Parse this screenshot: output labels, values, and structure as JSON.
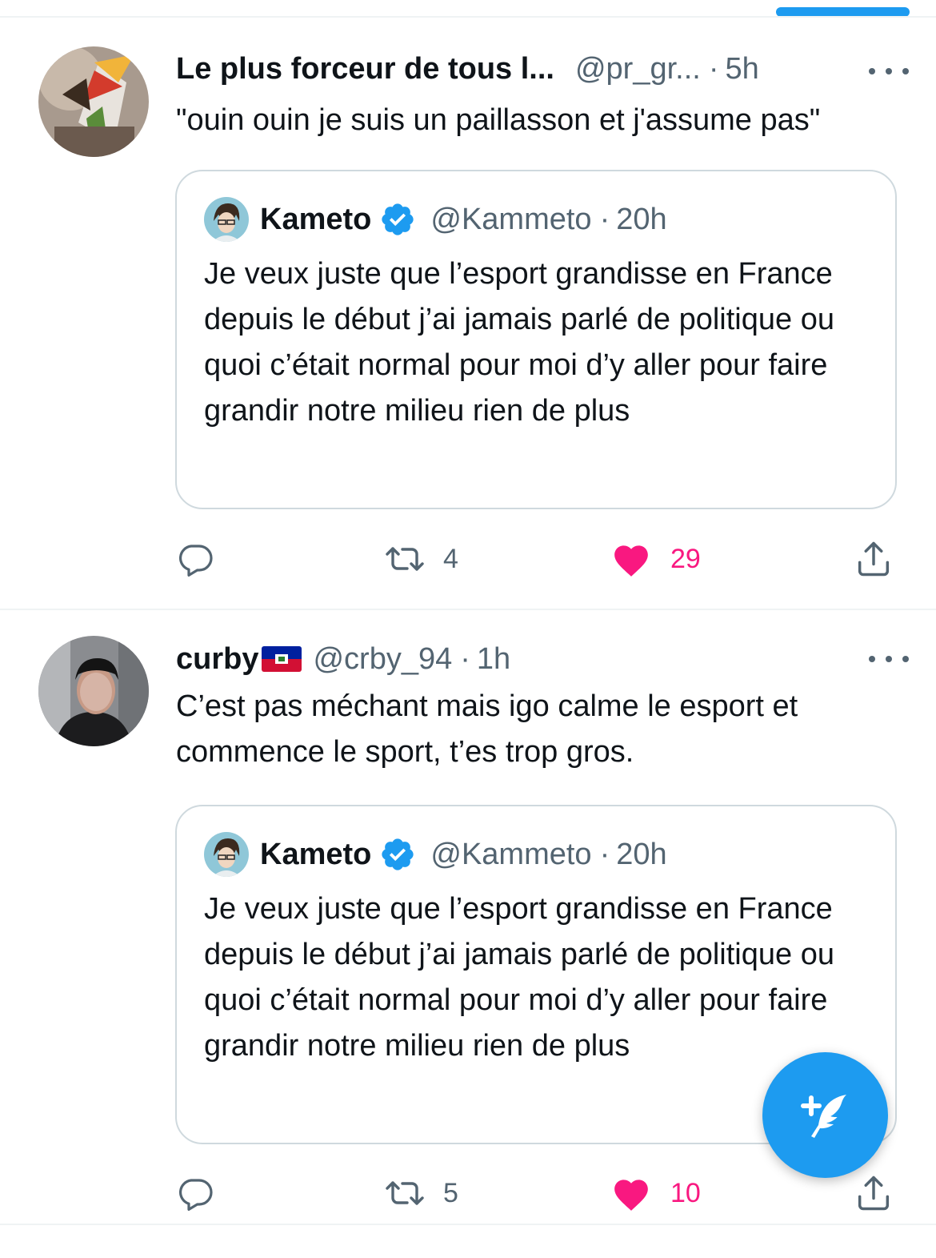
{
  "tweets": [
    {
      "name": "Le plus forceur de tous l...",
      "handle": "@pr_gr...",
      "dot": "·",
      "time": "5h",
      "text": "\"ouin ouin je suis un paillasson et j'assume pas\"",
      "quote": {
        "name": "Kameto",
        "handle": "@Kammeto",
        "dot": "·",
        "time": "20h",
        "text": "Je veux juste que l’esport grandisse en France depuis le début j’ai jamais parlé de politique ou quoi c’était normal pour moi d’y aller pour faire grandir notre milieu rien de plus"
      },
      "actions": {
        "replies": "",
        "retweets": "4",
        "likes": "29",
        "liked": true
      }
    },
    {
      "name": "curby",
      "flag": "haiti-flag",
      "handle": "@crby_94",
      "dot": "·",
      "time": "1h",
      "text": "C’est pas méchant mais igo calme le esport et commence le sport, t’es trop gros.",
      "quote": {
        "name": "Kameto",
        "handle": "@Kammeto",
        "dot": "·",
        "time": "20h",
        "text": "Je veux juste que l’esport grandisse en France depuis le début j’ai jamais parlé de politique ou quoi c’était normal pour moi d’y aller pour faire grandir notre milieu rien de plus"
      },
      "actions": {
        "replies": "",
        "retweets": "5",
        "likes": "10",
        "liked": true
      }
    }
  ],
  "icons": {
    "reply": "speech-bubble-icon",
    "retweet": "retweet-icon",
    "like": "heart-icon",
    "share": "share-icon",
    "more": "more-dots-icon",
    "verified": "verified-badge-icon",
    "compose": "compose-feather-icon"
  },
  "colors": {
    "accent": "#1d9bf0",
    "like": "#f91880",
    "secondary_text": "#536471",
    "border": "#cfd9de"
  }
}
